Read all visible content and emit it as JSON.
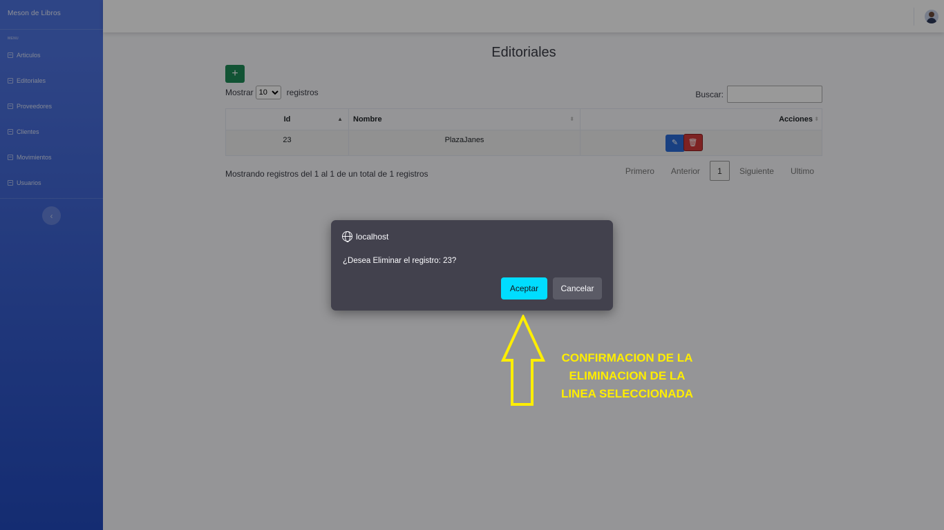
{
  "sidebar": {
    "brand": "Meson de Libros",
    "heading": "MENU",
    "items": [
      {
        "label": "Articulos"
      },
      {
        "label": "Editoriales"
      },
      {
        "label": "Proveedores"
      },
      {
        "label": "Clientes"
      },
      {
        "label": "Movimientos"
      },
      {
        "label": "Usuarios"
      }
    ]
  },
  "page": {
    "title": "Editoriales",
    "add_label": "+",
    "length": {
      "prefix": "Mostrar",
      "value": "10",
      "suffix": "registros"
    },
    "search_label": "Buscar:"
  },
  "table": {
    "headers": [
      "Id",
      "Nombre",
      "Acciones"
    ],
    "rows": [
      {
        "id": "23",
        "nombre": "PlazaJanes"
      }
    ]
  },
  "footer": {
    "info": "Mostrando registros del 1 al 1 de un total de 1 registros",
    "pager": {
      "first": "Primero",
      "prev": "Anterior",
      "current": "1",
      "next": "Siguiente",
      "last": "Ultimo"
    }
  },
  "dialog": {
    "origin": "localhost",
    "message": "¿Desea Eliminar el registro: 23?",
    "ok_label": "Aceptar",
    "cancel_label": "Cancelar",
    "ok_color": "#00ddff"
  },
  "annotation": {
    "lines": [
      "CONFIRMACION DE LA",
      "ELIMINACION DE LA",
      "LINEA SELECCIONADA"
    ],
    "color": "#ffee00"
  }
}
